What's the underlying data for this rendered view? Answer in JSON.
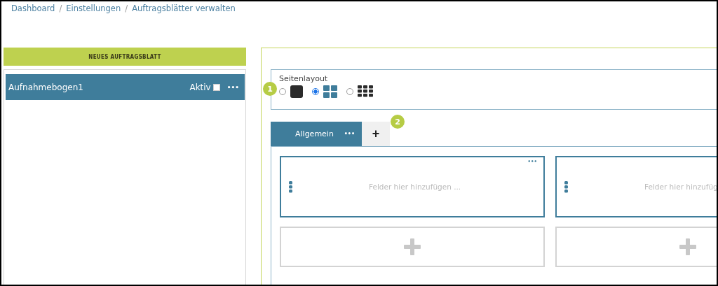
{
  "breadcrumb": {
    "separator": "/",
    "items": [
      "Dashboard",
      "Einstellungen",
      "Auftragsblätter verwalten"
    ]
  },
  "new_button": "NEUES AUFTRAGSBLATT",
  "sheets": [
    {
      "name": "Aufnahmebogen1",
      "selected": true,
      "active_label": "Aktiv",
      "active": false,
      "menu": "•••"
    }
  ],
  "layout": {
    "label": "Seitenlayout",
    "badge": "1",
    "options": [
      {
        "kind": "single",
        "selected": false
      },
      {
        "kind": "grid4",
        "selected": true
      },
      {
        "kind": "grid9",
        "selected": false
      }
    ]
  },
  "tabs": [
    {
      "label": "Allgemein",
      "menu": "•••",
      "selected": true
    }
  ],
  "add_tab": {
    "label": "+",
    "badge": "2"
  },
  "columns": [
    {
      "placeholder": "Felder hier hinzufügen ...",
      "menu": "•••"
    },
    {
      "placeholder": "Felder hier hinzufüg"
    }
  ]
}
